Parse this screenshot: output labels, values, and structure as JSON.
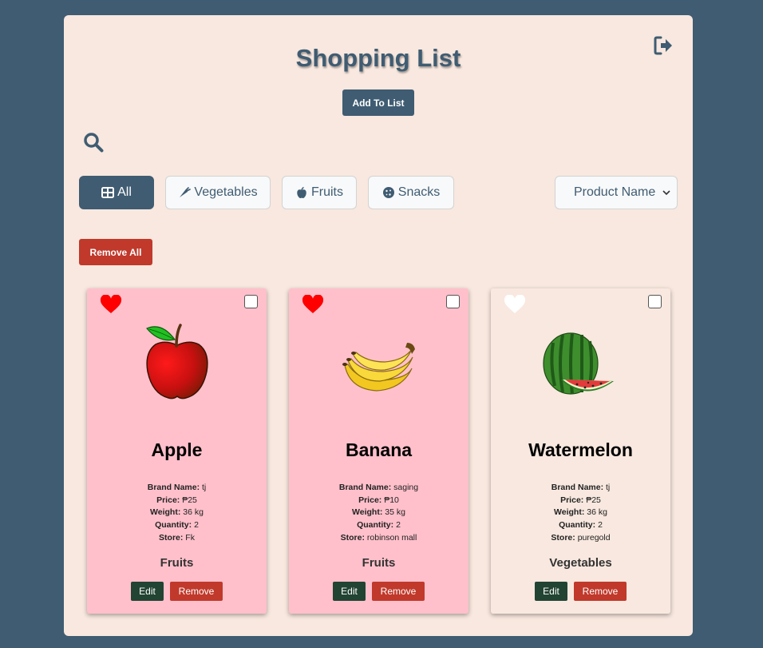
{
  "header": {
    "title": "Shopping List",
    "add_label": "Add To List"
  },
  "icons": {
    "logout": "logout-icon",
    "search": "search-icon"
  },
  "filters": [
    {
      "label": "All",
      "icon": "grid-icon",
      "active": true
    },
    {
      "label": "Vegetables",
      "icon": "carrot-icon",
      "active": false
    },
    {
      "label": "Fruits",
      "icon": "apple-icon",
      "active": false
    },
    {
      "label": "Snacks",
      "icon": "cookie-icon",
      "active": false
    }
  ],
  "sort": {
    "selected": "Product Name"
  },
  "remove_all_label": "Remove All",
  "field_labels": {
    "brand": "Brand Name:",
    "price": "Price:",
    "weight": "Weight:",
    "quantity": "Quantity:",
    "store": "Store:"
  },
  "products": [
    {
      "name": "Apple",
      "favorite": true,
      "brand": "tj",
      "price": "₱25",
      "weight": "36 kg",
      "quantity": "2",
      "store": "Fk",
      "category": "Fruits",
      "edit_label": "Edit",
      "remove_label": "Remove"
    },
    {
      "name": "Banana",
      "favorite": true,
      "brand": "saging",
      "price": "₱10",
      "weight": "35 kg",
      "quantity": "2",
      "store": "robinson mall",
      "category": "Fruits",
      "edit_label": "Edit",
      "remove_label": "Remove"
    },
    {
      "name": "Watermelon",
      "favorite": false,
      "brand": "tj",
      "price": "₱25",
      "weight": "36 kg",
      "quantity": "2",
      "store": "puregold",
      "category": "Vegetables",
      "edit_label": "Edit",
      "remove_label": "Remove"
    }
  ],
  "colors": {
    "background": "#3f5c72",
    "panel": "#f8e8df",
    "accent": "#3f5c72",
    "danger": "#c0392b",
    "edit": "#224433",
    "favorite_card": "#ffc0cb",
    "heart_red": "#ff0000"
  }
}
